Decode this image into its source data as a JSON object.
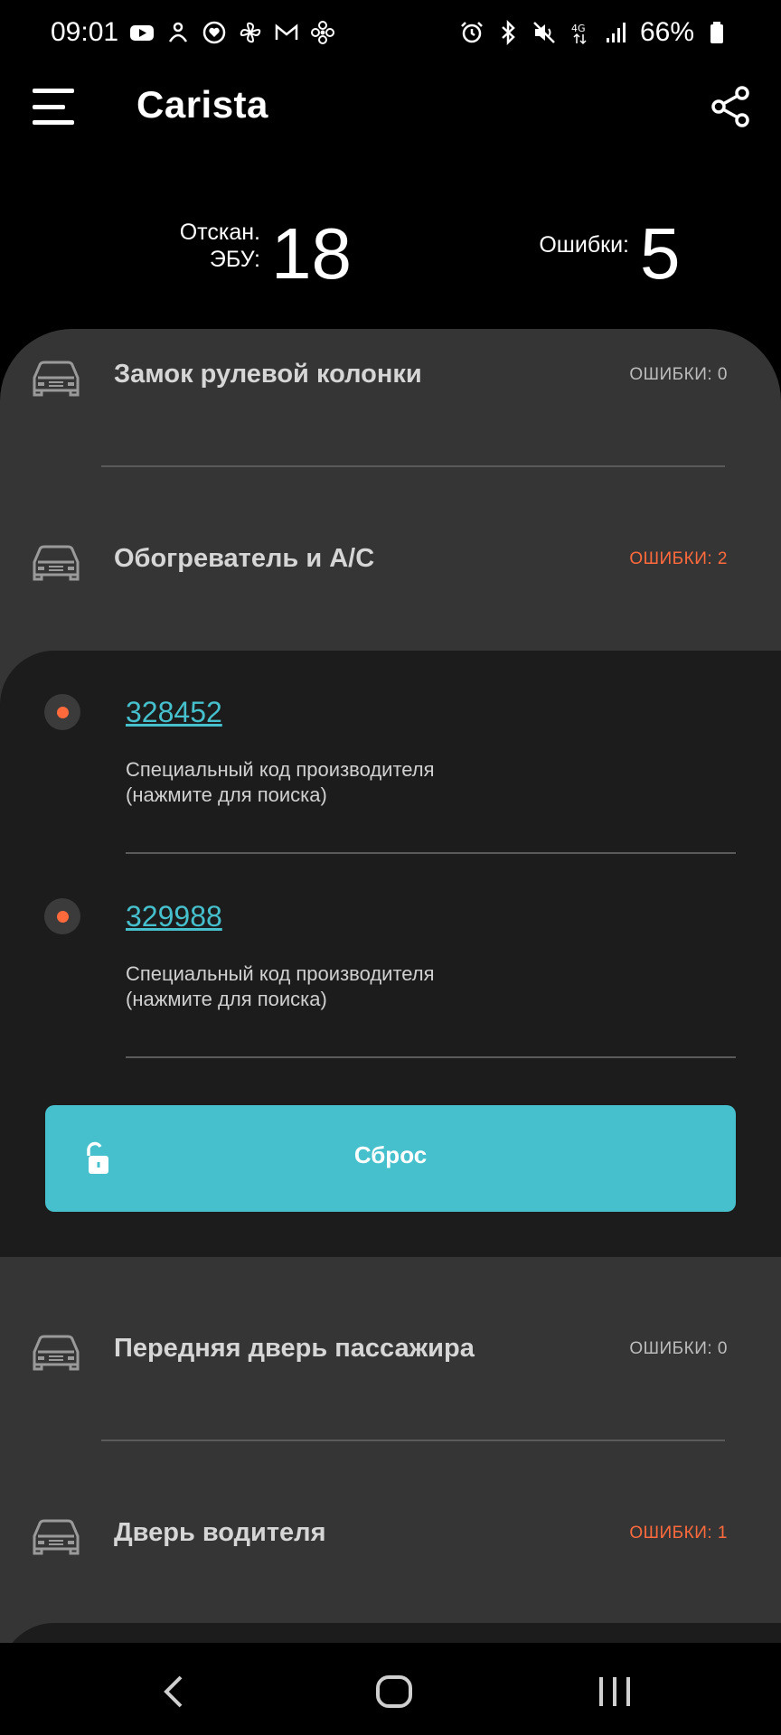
{
  "status_bar": {
    "time": "09:01",
    "battery": "66%",
    "network": "4G",
    "left_icons": [
      "youtube-icon",
      "app-icon",
      "heart-icon",
      "pinwheel-icon",
      "gmail-icon",
      "fan-icon"
    ],
    "right_icons": [
      "alarm-icon",
      "bluetooth-icon",
      "mute-icon",
      "network-4g-icon",
      "signal-icon",
      "battery-icon"
    ]
  },
  "app_bar": {
    "title": "Carista"
  },
  "stats": {
    "scanned_label_line1": "Отскан.",
    "scanned_label_line2": "ЭБУ:",
    "scanned_value": "18",
    "errors_label": "Ошибки:",
    "errors_value": "5"
  },
  "ecus": [
    {
      "name": "Замок рулевой колонки",
      "errors": "ОШИБКИ: 0",
      "error_count": 0
    },
    {
      "name": "Обогреватель и A/C",
      "errors": "ОШИБКИ: 2",
      "error_count": 2
    },
    {
      "name": "Передняя дверь пассажира",
      "errors": "ОШИБКИ: 0",
      "error_count": 0
    },
    {
      "name": "Дверь водителя",
      "errors": "ОШИБКИ: 1",
      "error_count": 1
    }
  ],
  "codes": [
    {
      "code": "328452",
      "desc_line1": "Специальный код производителя",
      "desc_line2": "(нажмите для поиска)"
    },
    {
      "code": "329988",
      "desc_line1": "Специальный код производителя",
      "desc_line2": "(нажмите для поиска)"
    }
  ],
  "reset_button": {
    "label": "Сброс"
  },
  "colors": {
    "accent": "#45c0cc",
    "error": "#ff6a3c",
    "ok": "#bcbcbc",
    "card": "#353535",
    "expanded": "#1c1c1c"
  }
}
